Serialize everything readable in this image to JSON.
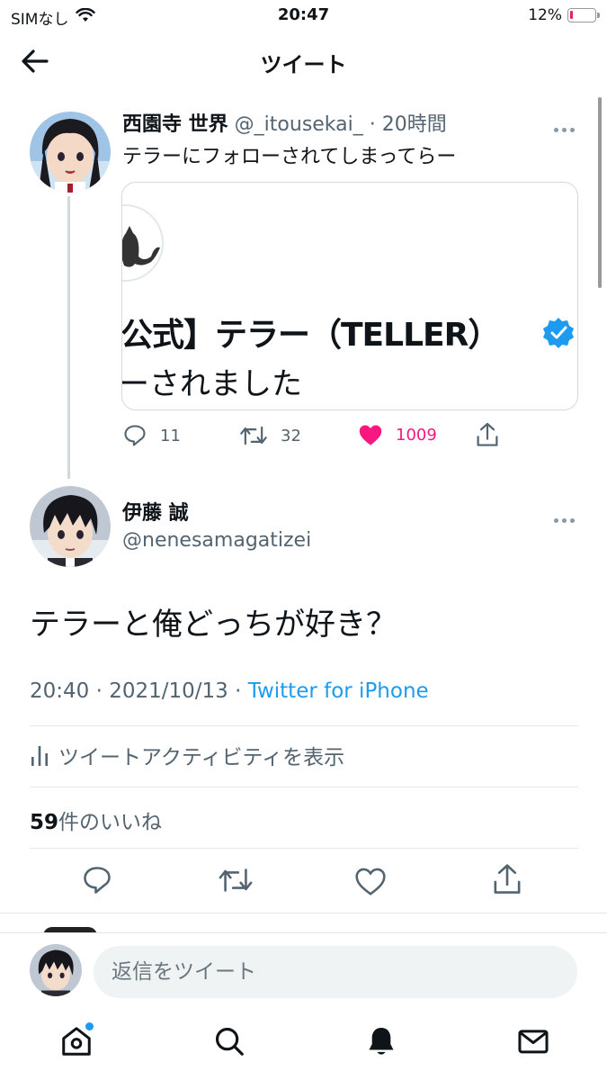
{
  "status_bar": {
    "carrier": "SIMなし",
    "time": "20:47",
    "battery": "12%",
    "battery_level": 0.12,
    "icons": [
      "wifi-icon",
      "battery-icon"
    ]
  },
  "header": {
    "title": "ツイート",
    "back_icon": "back-arrow-icon"
  },
  "quoted_tweet": {
    "name": "西園寺 世界",
    "handle": "@_itousekai_",
    "time": "· 20時間",
    "text": "テラーにフォローされてしまってらー",
    "card": {
      "title": "公式】テラー（TELLER）",
      "subtitle": "ーされました",
      "badge_color": "#1d9bf0"
    },
    "actions": {
      "replies": "11",
      "retweets": "32",
      "likes": "1009",
      "like_color": "#f91880"
    }
  },
  "main_tweet": {
    "name": "伊藤 誠",
    "handle": "@nenesamagatizei",
    "text": "テラーと俺どっちが好き？",
    "timestamp": "20:40 · 2021/10/13 · ",
    "source": "Twitter for iPhone",
    "activity_label": "ツイートアクティビティを表示",
    "likes_count": "59",
    "likes_label": "件のいいね"
  },
  "composer": {
    "placeholder": "返信をツイート"
  },
  "tabbar": {
    "tabs": [
      "home-icon",
      "search-icon",
      "bell-icon",
      "mail-icon"
    ],
    "active": "bell-icon"
  }
}
